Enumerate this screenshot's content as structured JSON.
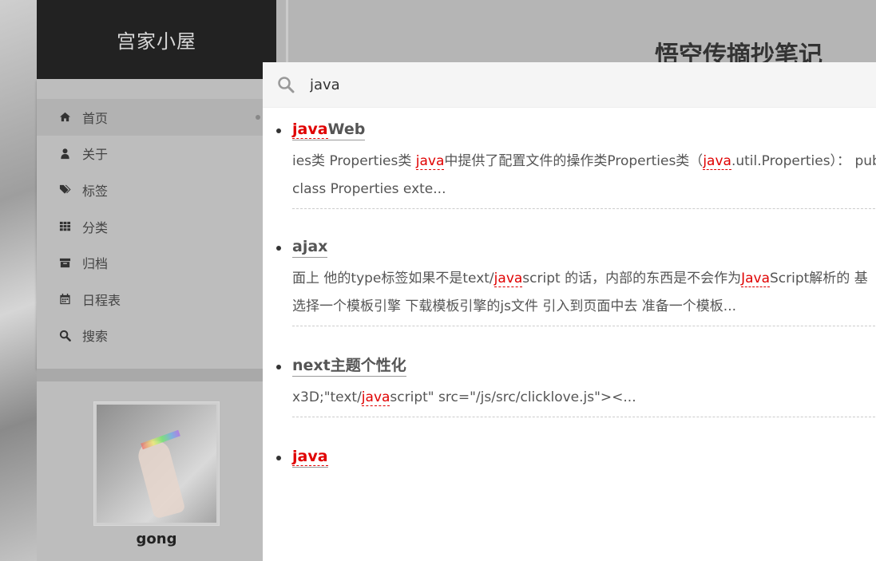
{
  "site": {
    "title": "宫家小屋"
  },
  "sidebar": {
    "menu": [
      {
        "label": "首页",
        "icon": "home-icon"
      },
      {
        "label": "关于",
        "icon": "user-icon"
      },
      {
        "label": "标签",
        "icon": "tags-icon"
      },
      {
        "label": "分类",
        "icon": "grid-icon"
      },
      {
        "label": "归档",
        "icon": "archive-icon"
      },
      {
        "label": "日程表",
        "icon": "calendar-icon"
      },
      {
        "label": "搜索",
        "icon": "search-icon"
      }
    ],
    "author": {
      "name": "gong"
    }
  },
  "post": {
    "title": "悟空传摘抄笔记"
  },
  "search": {
    "query": "java",
    "results": [
      {
        "title_parts": [
          "java",
          "Web"
        ],
        "excerpt_lines": [
          [
            "ies类 Properties类 ",
            "java",
            "中提供了配置文件的操作类Properties类（",
            "java",
            ".util.Properties）： public"
          ],
          [
            "class Properties exte..."
          ]
        ]
      },
      {
        "title_parts": [
          "",
          "ajax"
        ],
        "excerpt_lines": [
          [
            "面上 他的type标签如果不是text/",
            "java",
            "script 的话，内部的东西是不会作为",
            "Java",
            "Script解析的 基"
          ],
          [
            "选择一个模板引擎 下载模板引擎的js文件 引入到页面中去 准备一个模板..."
          ]
        ]
      },
      {
        "title_parts": [
          "",
          "next主题个性化"
        ],
        "excerpt_lines": [
          [
            "x3D;\"text/",
            "java",
            "script\" src=\"/js/src/clicklove.js\"><..."
          ]
        ]
      },
      {
        "title_parts": [
          "java",
          ""
        ],
        "excerpt_lines": []
      }
    ]
  },
  "colors": {
    "highlight": "#e00000",
    "brand_bg": "#222222",
    "overlay": "#b5b5b5"
  }
}
